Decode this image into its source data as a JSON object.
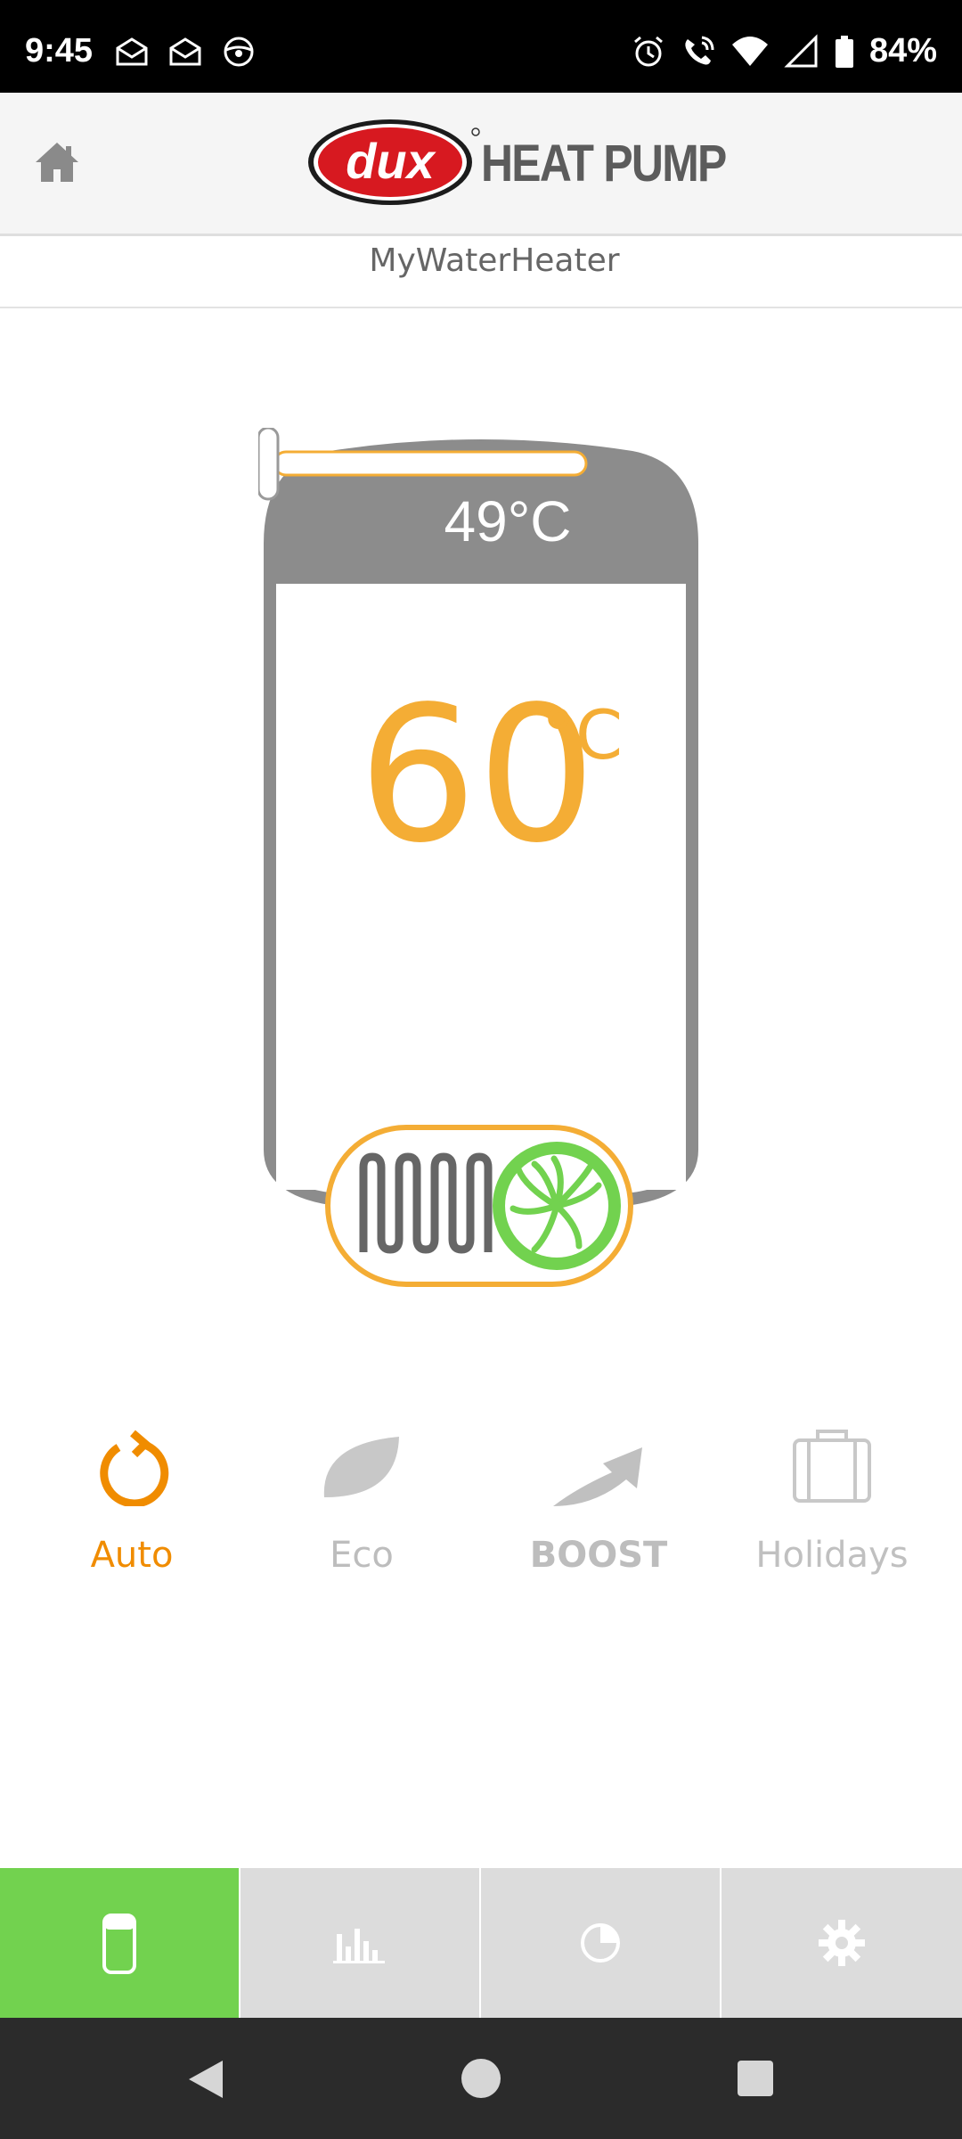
{
  "status_bar": {
    "time": "9:45",
    "battery": "84%"
  },
  "header": {
    "brand": "dux",
    "title": "HEAT PUMP"
  },
  "device": {
    "name": "MyWaterHeater"
  },
  "tank": {
    "current_temp": "49°C",
    "setpoint": "60",
    "unit": "°C",
    "slider_level": 0.0
  },
  "modes": [
    {
      "label": "Auto",
      "active": true
    },
    {
      "label": "Eco",
      "active": false
    },
    {
      "label": "BOOST",
      "active": false
    },
    {
      "label": "Holidays",
      "active": false
    }
  ],
  "tabs": [
    "tank-icon",
    "bar-chart-icon",
    "pie-chart-icon",
    "gear-icon"
  ],
  "colors": {
    "accent": "#f4ad35",
    "active_tab": "#72d24f",
    "tank_gray": "#8c8c8c",
    "mode_active": "#f08c00"
  }
}
